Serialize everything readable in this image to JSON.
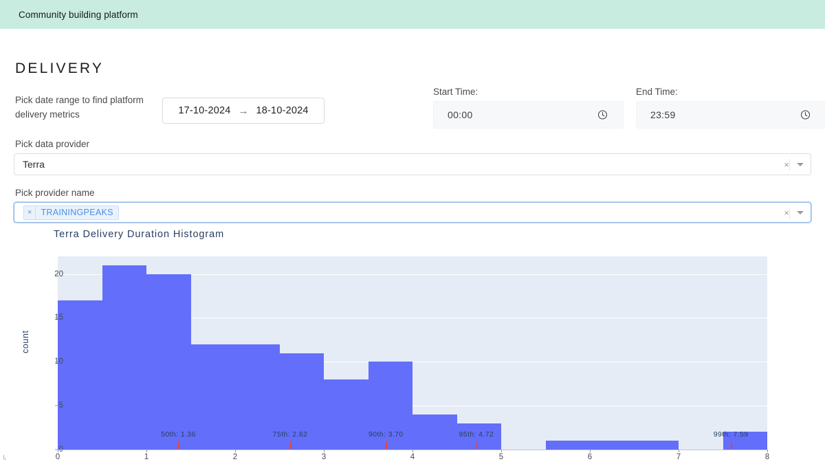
{
  "topbar": {
    "title": "Community building platform"
  },
  "page": {
    "title": "DELIVERY"
  },
  "date_range": {
    "label": "Pick date range to find platform delivery metrics",
    "start": "17-10-2024",
    "arrow": "→",
    "end": "18-10-2024"
  },
  "start_time": {
    "label": "Start Time:",
    "value": "00:00",
    "icon": "clock-icon"
  },
  "end_time": {
    "label": "End Time:",
    "value": "23:59",
    "icon": "clock-icon"
  },
  "data_provider": {
    "label": "Pick data provider",
    "value": "Terra",
    "clear": "×",
    "caret_icon": "chevron-down-icon"
  },
  "provider_name": {
    "label": "Pick provider name",
    "tag": "TRAININGPEAKS",
    "tag_remove": "×",
    "clear": "×",
    "caret_icon": "chevron-down-icon"
  },
  "chart_data": {
    "type": "bar",
    "title": "Terra Delivery Duration Histogram",
    "xlabel": "",
    "ylabel": "count",
    "xlim": [
      0,
      8
    ],
    "ylim": [
      0,
      22
    ],
    "bin_width": 0.5,
    "grid": true,
    "legend": null,
    "plot_bgcolor": "#e5ecf6",
    "bar_color": "#636efa",
    "marker_color": "#e8443a",
    "ytick_labels": [
      "0",
      "5",
      "10",
      "15",
      "20"
    ],
    "ytick_values": [
      0,
      5,
      10,
      15,
      20
    ],
    "xtick_labels": [
      "0",
      "1",
      "2",
      "3",
      "4",
      "5",
      "6",
      "7",
      "8"
    ],
    "xtick_values": [
      0,
      1,
      2,
      3,
      4,
      5,
      6,
      7,
      8
    ],
    "bins": [
      {
        "x0": 0.0,
        "x1": 0.5,
        "count": 17
      },
      {
        "x0": 0.5,
        "x1": 1.0,
        "count": 21
      },
      {
        "x0": 1.0,
        "x1": 1.5,
        "count": 20
      },
      {
        "x0": 1.5,
        "x1": 2.0,
        "count": 12
      },
      {
        "x0": 2.0,
        "x1": 2.5,
        "count": 12
      },
      {
        "x0": 2.5,
        "x1": 3.0,
        "count": 11
      },
      {
        "x0": 3.0,
        "x1": 3.5,
        "count": 8
      },
      {
        "x0": 3.5,
        "x1": 4.0,
        "count": 10
      },
      {
        "x0": 4.0,
        "x1": 4.5,
        "count": 4
      },
      {
        "x0": 4.5,
        "x1": 5.0,
        "count": 3
      },
      {
        "x0": 5.0,
        "x1": 5.5,
        "count": 0
      },
      {
        "x0": 5.5,
        "x1": 6.0,
        "count": 1
      },
      {
        "x0": 6.0,
        "x1": 6.5,
        "count": 1
      },
      {
        "x0": 6.5,
        "x1": 7.0,
        "count": 1
      },
      {
        "x0": 7.0,
        "x1": 7.5,
        "count": 0
      },
      {
        "x0": 7.5,
        "x1": 8.0,
        "count": 2
      }
    ],
    "percentiles": [
      {
        "label": "50th: 1.36",
        "value": 1.36
      },
      {
        "label": "75th: 2.62",
        "value": 2.62
      },
      {
        "label": "90th: 3.70",
        "value": 3.7
      },
      {
        "label": "95th: 4.72",
        "value": 4.72
      },
      {
        "label": "99th: 7.59",
        "value": 7.59
      }
    ]
  }
}
